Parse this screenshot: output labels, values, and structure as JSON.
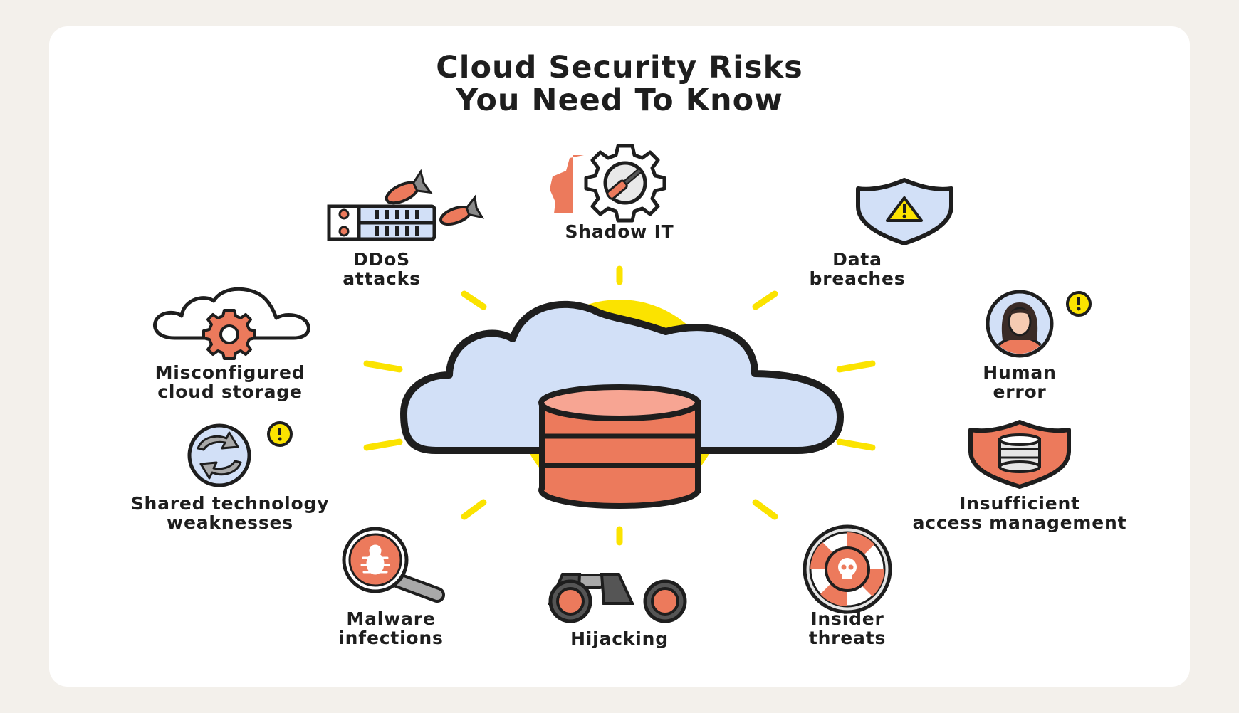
{
  "title": {
    "line1": "Cloud Security Risks",
    "line2": "You Need To Know"
  },
  "colors": {
    "background": "#f3f0eb",
    "card": "#ffffff",
    "accent_coral": "#ec7a5c",
    "accent_yellow": "#fbe300",
    "cloud_fill": "#d2e0f7",
    "outline": "#1e1e1e"
  },
  "risks": [
    {
      "id": "ddos",
      "icon": "server-with-missiles-icon",
      "lines": [
        "DDoS",
        "attacks"
      ]
    },
    {
      "id": "shadow-it",
      "icon": "gear-with-screwdriver-icon",
      "lines": [
        "Shadow IT"
      ]
    },
    {
      "id": "data-breaches",
      "icon": "warning-shield-icon",
      "lines": [
        "Data",
        "breaches"
      ]
    },
    {
      "id": "misconfigured",
      "icon": "cloud-gear-icon",
      "lines": [
        "Misconfigured",
        "cloud storage"
      ]
    },
    {
      "id": "human-error",
      "icon": "person-alert-icon",
      "lines": [
        "Human",
        "error"
      ]
    },
    {
      "id": "shared-tech",
      "icon": "sync-alert-icon",
      "lines": [
        "Shared technology",
        "weaknesses"
      ]
    },
    {
      "id": "access-mgmt",
      "icon": "database-shield-icon",
      "lines": [
        "Insufficient",
        "access management"
      ]
    },
    {
      "id": "malware",
      "icon": "bug-magnifier-icon",
      "lines": [
        "Malware",
        "infections"
      ]
    },
    {
      "id": "hijacking",
      "icon": "binoculars-icon",
      "lines": [
        "Hijacking"
      ]
    },
    {
      "id": "insider",
      "icon": "skull-lifebuoy-icon",
      "lines": [
        "Insider",
        "threats"
      ]
    }
  ],
  "center": {
    "icon": "cloud-database-icon"
  }
}
